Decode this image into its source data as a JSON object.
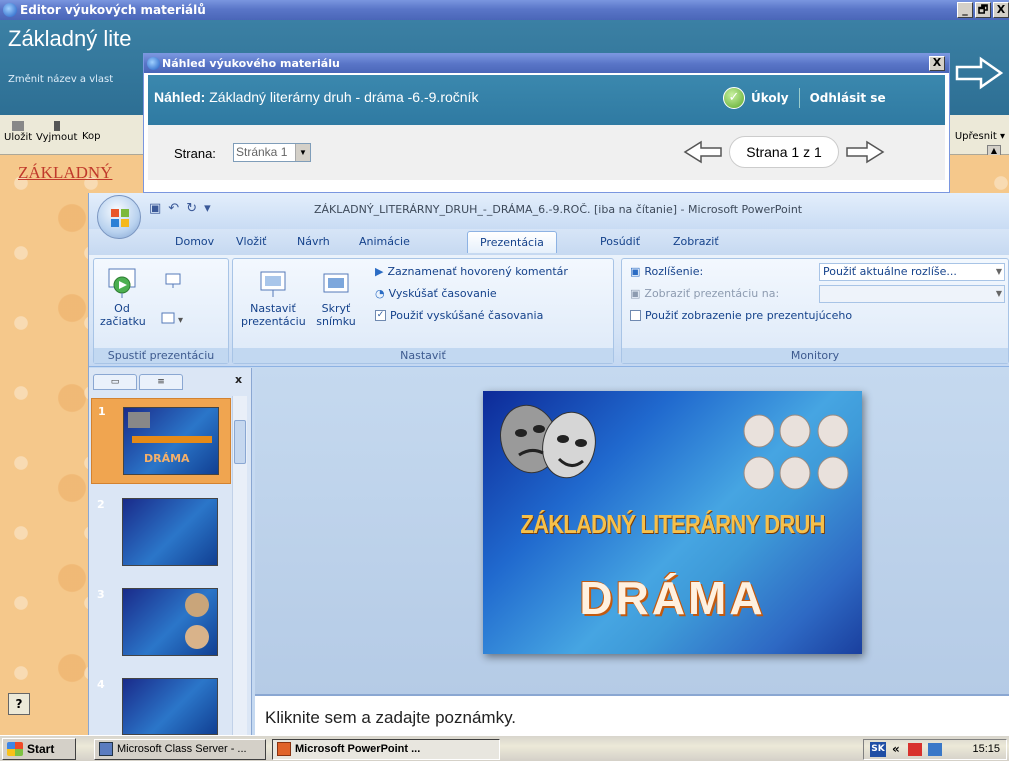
{
  "outer_window": {
    "title": "Editor výukových materiálů",
    "buttons": [
      "_",
      "🗗",
      "X"
    ]
  },
  "editor": {
    "title": "Základný lite",
    "subtitle": "Změnit název a vlast",
    "toolbar": {
      "save": "Uložit",
      "cut": "Vyjmout",
      "copy": "Kop",
      "refine": "Upřesnit"
    },
    "doc_title": "ZÁKLADNÝ"
  },
  "preview": {
    "title": "Náhled výukového materiálu",
    "close": "X",
    "heading_label": "Náhled:",
    "heading_value": " Základný literárny druh - dráma -6.-9.ročník",
    "tasks_link": "Úkoly",
    "logout_link": "Odhlásit se",
    "page_label": "Strana:",
    "page_select_value": "Stránka 1",
    "page_indicator": "Strana  1 z 1"
  },
  "ppt": {
    "window_title": "ZÁKLADNÝ_LITERÁRNY_DRUH_-_DRÁMA_6.-9.ROČ. [iba na čítanie] - Microsoft PowerPoint",
    "tabs": [
      "Domov",
      "Vložiť",
      "Návrh",
      "Animácie",
      "Prezentácia",
      "Posúdiť",
      "Zobraziť"
    ],
    "active_tab": "Prezentácia",
    "ribbon": {
      "group_start": {
        "name": "Spustiť prezentáciu",
        "from_start_l1": "Od",
        "from_start_l2": "začiatku"
      },
      "group_setup": {
        "name": "Nastaviť",
        "setup_l1": "Nastaviť",
        "setup_l2": "prezentáciu",
        "hide_l1": "Skryť",
        "hide_l2": "snímku",
        "record": "Zaznamenať hovorený komentár",
        "rehearse": "Vyskúšať časovanie",
        "use_timings": "Použiť vyskúšané časovania"
      },
      "group_monitors": {
        "name": "Monitory",
        "resolution_label": "Rozlíšenie:",
        "resolution_value": "Použiť aktuálne rozlíše...",
        "show_on_label": "Zobraziť prezentáciu na:",
        "presenter_view": "Použiť zobrazenie pre prezentujúceho"
      }
    },
    "slides": [
      "1",
      "2",
      "3",
      "4"
    ],
    "slide": {
      "title_line1": "ZÁKLADNÝ LITERÁRNY DRUH",
      "title_line2": "DRÁMA"
    },
    "thumb1_text": "DRÁMA",
    "notes_placeholder": "Kliknite sem a zadajte poznámky."
  },
  "taskbar": {
    "start": "Start",
    "tasks": [
      "Microsoft Class Server - ...",
      "Microsoft PowerPoint ..."
    ],
    "lang": "SK",
    "chevron": "«",
    "time": "15:15"
  },
  "colors": {
    "xp_blue": "#5a76c8",
    "editor_teal": "#2d6f94",
    "ppt_ribbon": "#d4e3f6",
    "slide_orange": "#f6c04a"
  }
}
